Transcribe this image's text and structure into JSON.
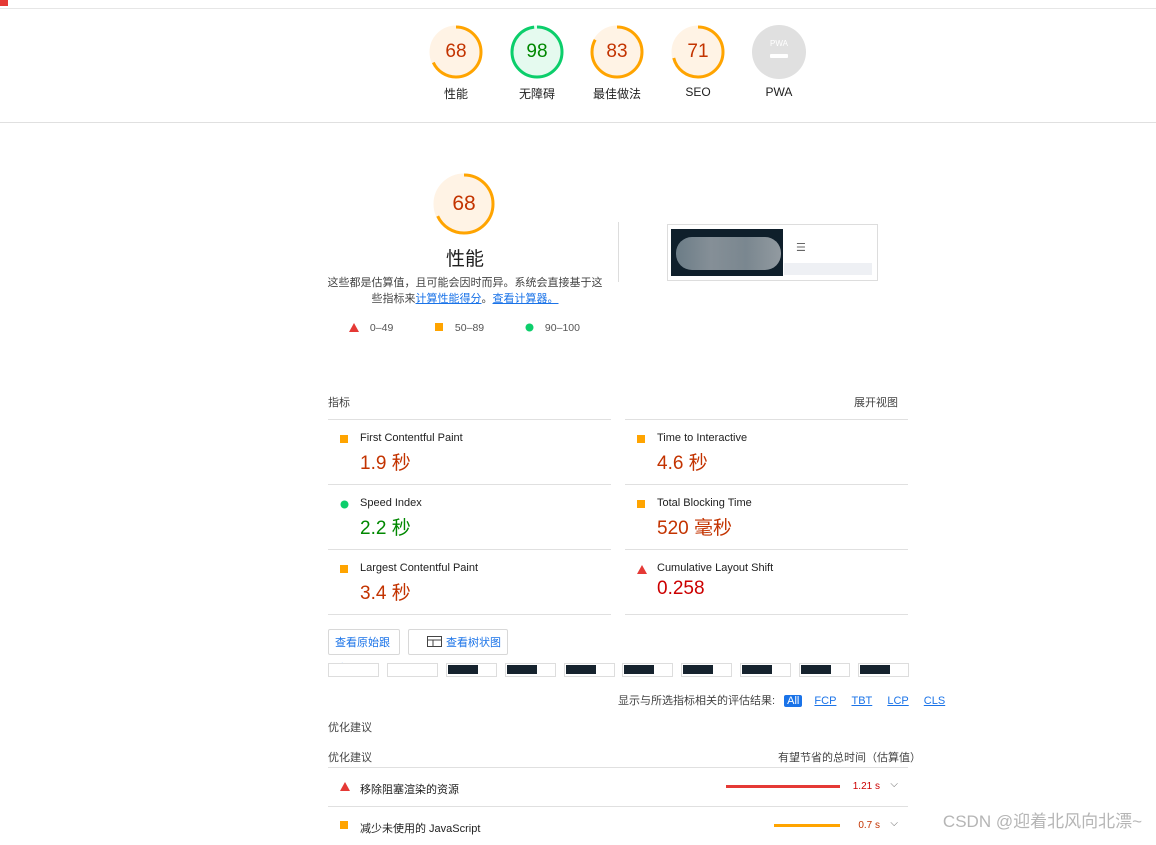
{
  "colors": {
    "fail": "#e53935",
    "average": "#ffa400",
    "pass": "#0cce6b",
    "avg_text": "#c33300",
    "pass_text": "#008800",
    "fail_text": "#cc0000",
    "link": "#1a73e8"
  },
  "summary_gauges": [
    {
      "score": "68",
      "label": "性能",
      "rating": "average",
      "fraction": 0.68
    },
    {
      "score": "98",
      "label": "无障碍",
      "rating": "pass",
      "fraction": 0.98
    },
    {
      "score": "83",
      "label": "最佳做法",
      "rating": "average",
      "fraction": 0.83
    },
    {
      "score": "71",
      "label": "SEO",
      "rating": "average",
      "fraction": 0.71
    },
    {
      "score": "PWA",
      "label": "PWA",
      "rating": "na",
      "fraction": 0
    }
  ],
  "performance": {
    "score": "68",
    "score_fraction": 0.68,
    "title": "性能",
    "desc_text": "这些都是估算值，且可能会因时而异。系统会直接基于这些指标来",
    "desc_link1": "计算性能得分",
    "desc_mid": "。",
    "desc_link2": "查看计算器。",
    "legend": [
      {
        "range": "0–49",
        "icon": "triangle-icon"
      },
      {
        "range": "50–89",
        "icon": "square-icon"
      },
      {
        "range": "90–100",
        "icon": "circle-icon"
      }
    ],
    "screenshot_menu_icon": "☰"
  },
  "metrics_section": {
    "title": "指标",
    "expand": "展开视图"
  },
  "metrics": [
    {
      "name": "First Contentful Paint",
      "value": "1.9 秒",
      "rating": "average"
    },
    {
      "name": "Time to Interactive",
      "value": "4.6 秒",
      "rating": "average"
    },
    {
      "name": "Speed Index",
      "value": "2.2 秒",
      "rating": "pass"
    },
    {
      "name": "Total Blocking Time",
      "value": "520 毫秒",
      "rating": "average"
    },
    {
      "name": "Largest Contentful Paint",
      "value": "3.4 秒",
      "rating": "average"
    },
    {
      "name": "Cumulative Layout Shift",
      "value": "0.258",
      "rating": "fail"
    }
  ],
  "buttons": {
    "trace": "查看原始跟踪",
    "treemap": "查看树状图"
  },
  "filters": {
    "label": "显示与所选指标相关的评估结果:",
    "chips": [
      "All",
      "FCP",
      "TBT",
      "LCP",
      "CLS"
    ],
    "active": "All"
  },
  "opportunities": {
    "section_title": "优化建议",
    "col_label": "优化建议",
    "col_savings": "有望节省的总时间（估算值）",
    "items": [
      {
        "name": "移除阻塞渲染的资源",
        "time": "1.21 s",
        "rating": "fail",
        "bar_fraction": 1.0
      },
      {
        "name": "减少未使用的 JavaScript",
        "time": "0.7 s",
        "rating": "average",
        "bar_fraction": 0.58
      }
    ]
  },
  "watermark": "CSDN @迎着北风向北漂~"
}
